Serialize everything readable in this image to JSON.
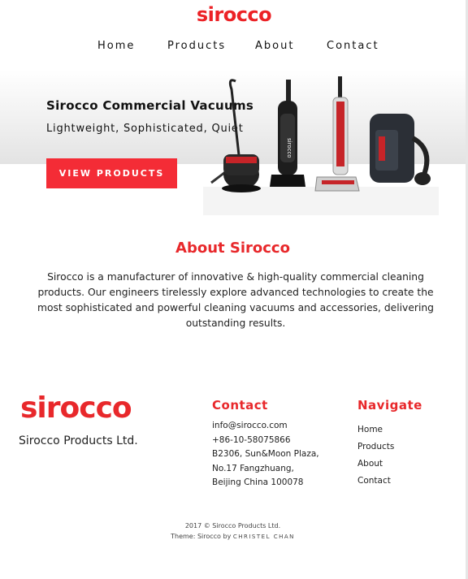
{
  "header": {
    "logo_text": "sirocco",
    "nav": [
      "Home",
      "Products",
      "About",
      "Contact"
    ]
  },
  "hero": {
    "title": "Sirocco Commercial Vacuums",
    "subtitle": "Lightweight, Sophisticated, Quiet",
    "button_label": "VIEW PRODUCTS",
    "image_label": "sirocco"
  },
  "about": {
    "title": "About Sirocco",
    "text": "Sirocco is a manufacturer of innovative & high-quality commercial cleaning products. Our engineers tirelessly explore advanced technologies to create the most sophisticated and powerful cleaning vacuums and accessories, delivering outstanding results."
  },
  "footer": {
    "logo_text": "sirocco",
    "company": "Sirocco Products Ltd.",
    "contact": {
      "title": "Contact",
      "email": "info@sirocco.com",
      "phone": "+86-10-58075866",
      "address_1": "B2306, Sun&Moon Plaza,",
      "address_2": "No.17 Fangzhuang,",
      "address_3": "Beijing China 100078"
    },
    "navigate": {
      "title": "Navigate",
      "links": [
        "Home",
        "Products",
        "About",
        "Contact"
      ]
    },
    "copyright": "2017 © Sirocco Products Ltd.",
    "theme_prefix": "Theme: Sirocco by",
    "theme_author": "CHRISTEL CHAN"
  },
  "colors": {
    "brand_red": "#e8282b",
    "button_red": "#f42c36"
  }
}
